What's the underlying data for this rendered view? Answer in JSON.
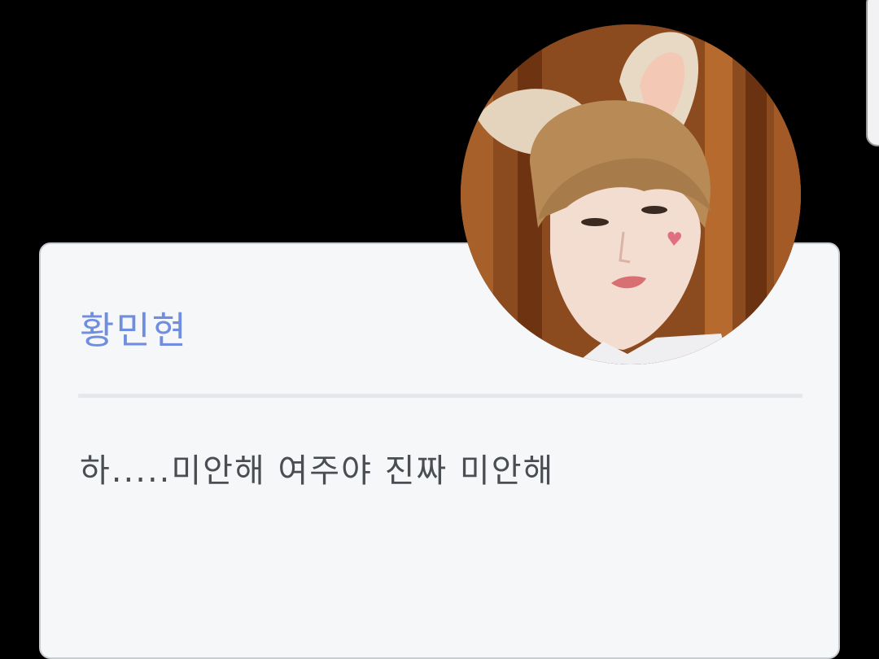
{
  "profile": {
    "name": "황민현",
    "name_color": "#6f8ee0"
  },
  "dialogue": {
    "text": "하.....미안해 여주야 진짜 미안해",
    "text_color": "#4a4d52"
  },
  "colors": {
    "background": "#000000",
    "card_background": "#f5f7f9",
    "card_border": "#c9ccd1",
    "divider": "#e5e7ea"
  },
  "icons": {
    "avatar": "profile-photo"
  }
}
